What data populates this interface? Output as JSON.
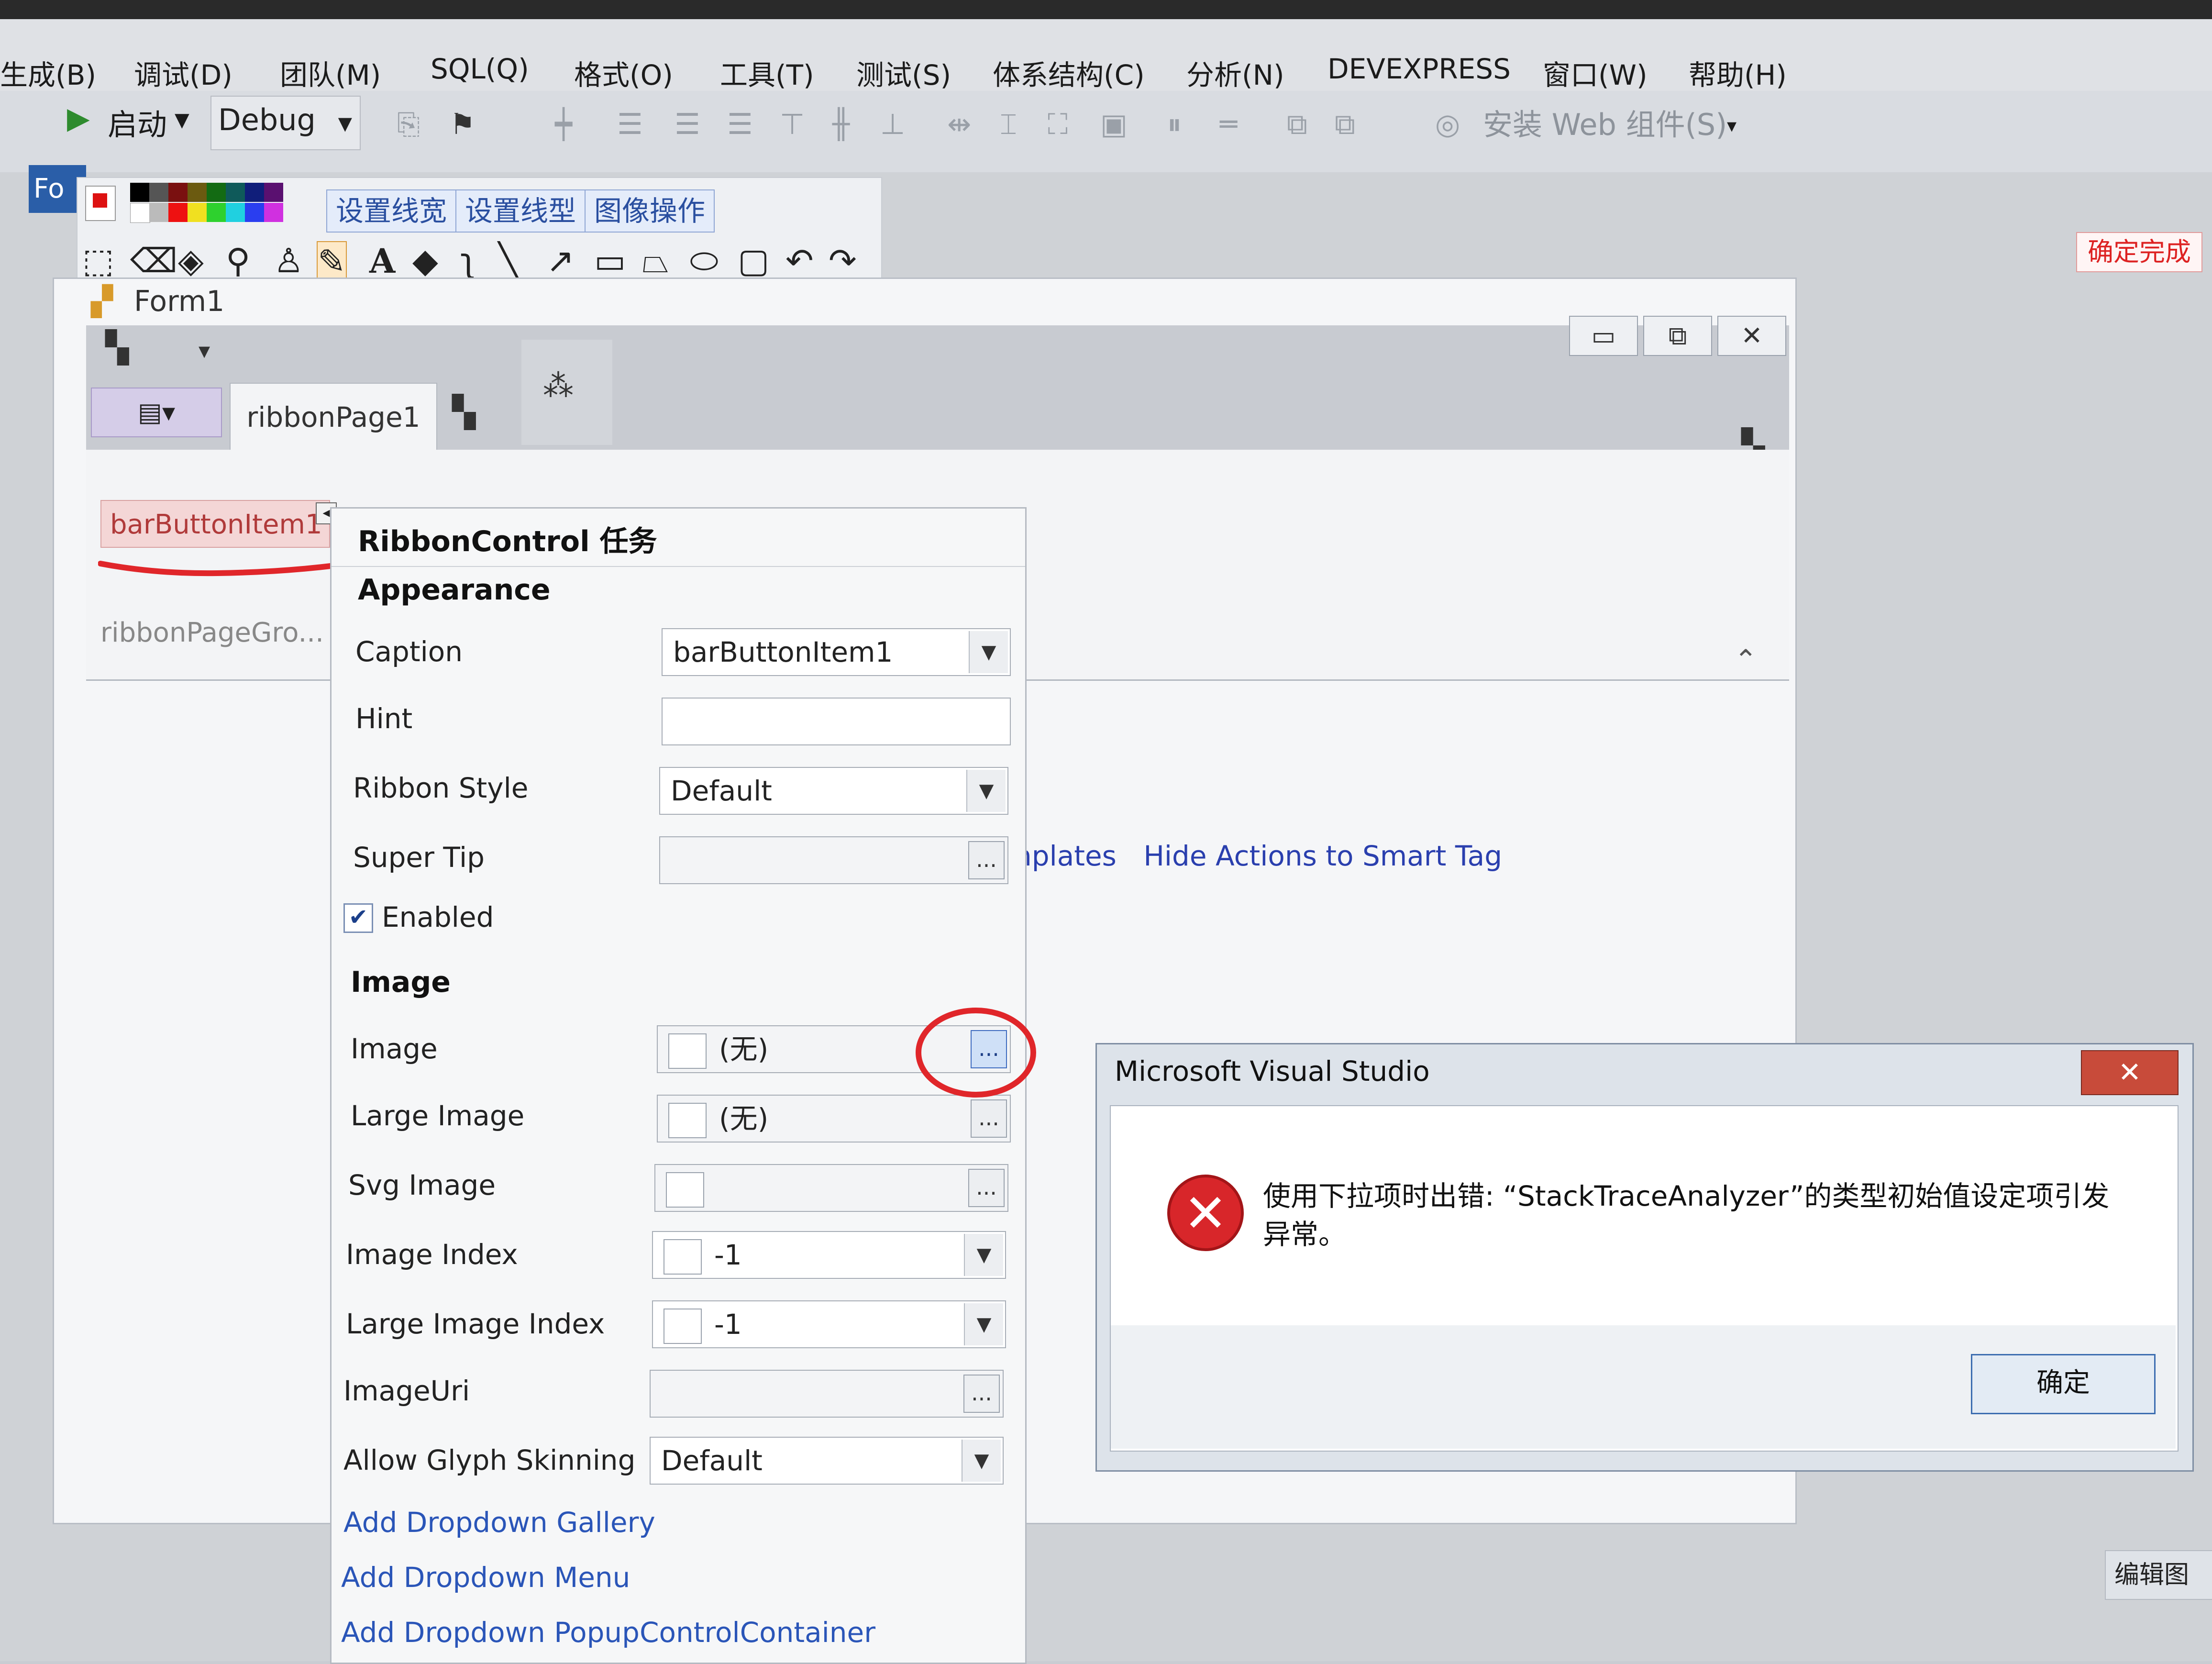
{
  "menu": {
    "items": [
      "生成(B)",
      "调试(D)",
      "团队(M)",
      "SQL(Q)",
      "格式(O)",
      "工具(T)",
      "测试(S)",
      "体系结构(C)",
      "分析(N)",
      "DEVEXPRESS",
      "窗口(W)",
      "帮助(H)"
    ]
  },
  "toolbar": {
    "start_label": "启动",
    "config_value": "Debug",
    "install_web_label": "安装 Web 组件(S)"
  },
  "doc_tab": {
    "label": "Fo"
  },
  "paint_toolbar": {
    "buttons": [
      "设置线宽",
      "设置线型",
      "图像操作"
    ],
    "confirm_label": "确定完成"
  },
  "form": {
    "title": "Form1",
    "ribbon_page_tab": "ribbonPage1",
    "bar_button_item": "barButtonItem1",
    "ribbon_group_label": "ribbonPageGro..."
  },
  "smart_links": {
    "templates": "nplates",
    "hide_actions": "Hide Actions to Smart Tag"
  },
  "task_panel": {
    "title": "RibbonControl 任务",
    "appearance_header": "Appearance",
    "caption_label": "Caption",
    "caption_value": "barButtonItem1",
    "hint_label": "Hint",
    "hint_value": "",
    "ribbon_style_label": "Ribbon Style",
    "ribbon_style_value": "Default",
    "super_tip_label": "Super Tip",
    "enabled_label": "Enabled",
    "enabled_checked": true,
    "image_header": "Image",
    "image_label": "Image",
    "image_value": "(无)",
    "large_image_label": "Large Image",
    "large_image_value": "(无)",
    "svg_image_label": "Svg Image",
    "image_index_label": "Image Index",
    "image_index_value": "-1",
    "large_image_index_label": "Large Image Index",
    "large_image_index_value": "-1",
    "image_uri_label": "ImageUri",
    "allow_glyph_label": "Allow Glyph Skinning",
    "allow_glyph_value": "Default",
    "links": [
      "Add Dropdown Gallery",
      "Add Dropdown Menu",
      "Add Dropdown PopupControlContainer"
    ],
    "ellipsis": "..."
  },
  "dialog": {
    "title": "Microsoft Visual Studio",
    "message": "使用下拉项时出错: “StackTraceAnalyzer”的类型初始值设定项引发异常。",
    "ok_label": "确定"
  },
  "status": {
    "edit_label": "编辑图"
  },
  "colors": {
    "annotation_red": "#e0262a",
    "link_blue": "#2a55b8",
    "error_red": "#d8262a"
  }
}
